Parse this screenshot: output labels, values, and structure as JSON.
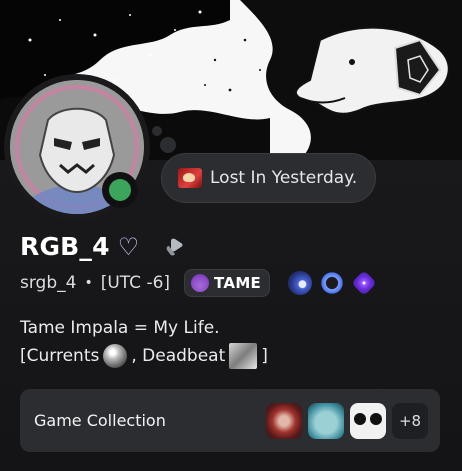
{
  "profile": {
    "display_name": "RGB_4",
    "name_decoration": "♡",
    "username": "srgb_4",
    "separator": "•",
    "timezone": "[UTC -6]",
    "guild_tag": "TAME",
    "status_text": "Lost In Yesterday.",
    "online_status": "online",
    "bio_line1": "Tame Impala = My Life.",
    "bio_line2_prefix": "[Currents",
    "bio_line2_mid": ", Deadbeat",
    "bio_line2_suffix": "]"
  },
  "game_collection": {
    "title": "Game Collection",
    "more_count": "+8"
  },
  "colors": {
    "background": "#1c1c1f",
    "card": "#2b2d31",
    "online": "#3ba55c",
    "heart": "#d7c8ff"
  },
  "icons": {
    "status_emoji": "red-album-art-icon",
    "nitro": "nitro-boost-icon",
    "guild_tag_icon": "purple-crescent-icon",
    "badges": [
      "orb-badge-icon",
      "laurel-badge-icon",
      "gem-badge-icon"
    ]
  }
}
